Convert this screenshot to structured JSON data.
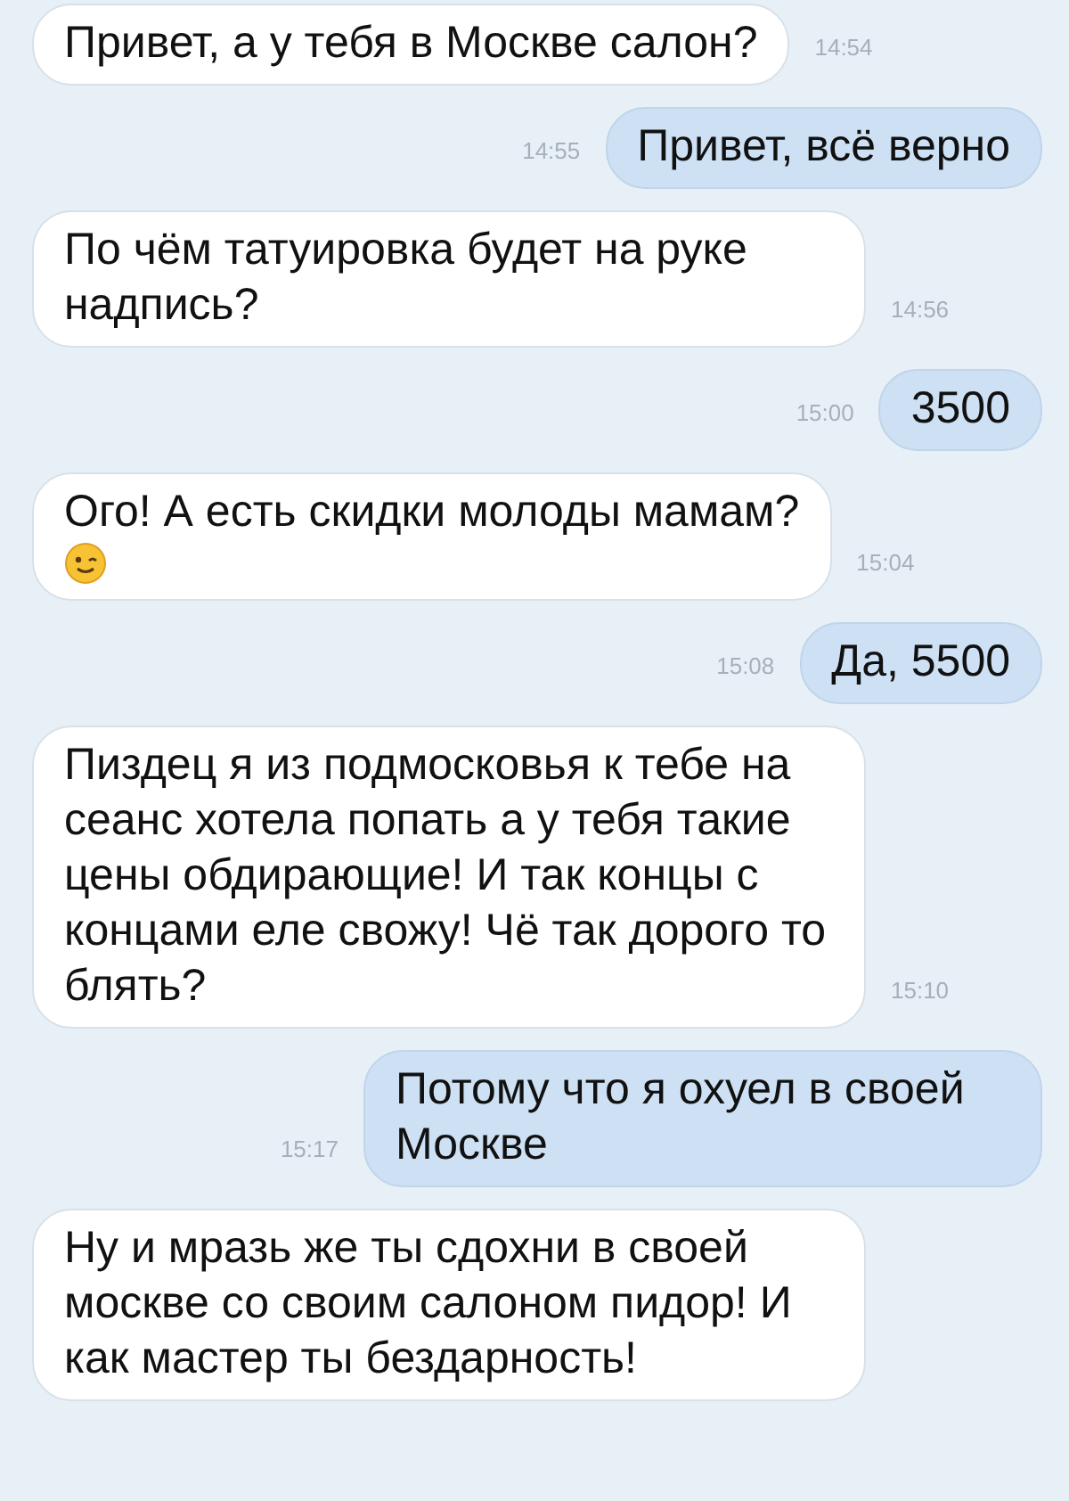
{
  "messages": [
    {
      "kind": "incoming",
      "text": "Привет, а у тебя в Москве салон?",
      "time": "14:54"
    },
    {
      "kind": "outgoing",
      "text": "Привет, всё верно",
      "time": "14:55"
    },
    {
      "kind": "incoming",
      "text": "По чём татуировка будет на руке надпись?",
      "time": "14:56"
    },
    {
      "kind": "outgoing",
      "text": "3500",
      "time": "15:00"
    },
    {
      "kind": "incoming",
      "text": "Ого! А есть скидки молоды мамам?",
      "emoji": true,
      "time": "15:04"
    },
    {
      "kind": "outgoing",
      "text": "Да, 5500",
      "time": "15:08"
    },
    {
      "kind": "incoming",
      "text": "Пиздец я из подмосковья к тебе на сеанс хотела попать а у тебя такие цены обдирающие! И так концы с концами еле свожу! Чё так дорого то блять?",
      "time": "15:10"
    },
    {
      "kind": "outgoing",
      "text": "Потому что я охуел в своей Москве",
      "time": "15:17"
    },
    {
      "kind": "incoming",
      "text": "Ну и мразь же ты сдохни в своей москве со своим салоном пидор! И как мастер ты бездарность!"
    }
  ]
}
